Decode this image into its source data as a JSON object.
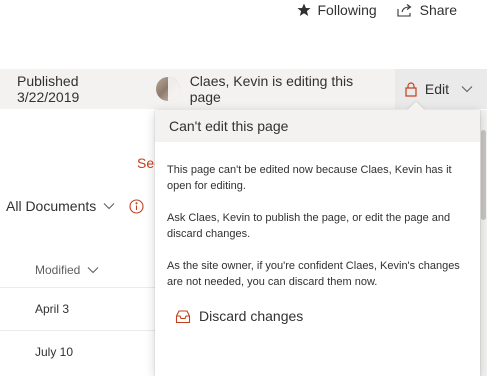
{
  "top_actions": {
    "following_label": "Following",
    "share_label": "Share"
  },
  "status_bar": {
    "published": "Published 3/22/2019",
    "editing_text": "Claes, Kevin is editing this page",
    "edit_label": "Edit"
  },
  "background": {
    "see_link": "See",
    "all_documents": "All Documents",
    "column_modified": "Modified",
    "rows": [
      "April 3",
      "July 10"
    ]
  },
  "callout": {
    "title": "Can't edit this page",
    "paragraphs": [
      "This page can't be edited now because Claes, Kevin has it open for editing.",
      "Ask Claes, Kevin to publish the page, or edit the page and discard changes.",
      "As the site owner, if you're confident Claes, Kevin's changes are not needed, you can discard them now."
    ],
    "discard_label": "Discard changes"
  },
  "colors": {
    "accent": "#c43e1c",
    "status_bar_bg": "#f3f2f1",
    "text": "#323130"
  },
  "icons": {
    "following": "star-icon",
    "share": "share-icon",
    "edit": "lock-icon",
    "edit_dropdown": "chevron-down-icon",
    "view_dropdown": "chevron-down-icon",
    "info": "info-icon",
    "sort": "chevron-down-icon",
    "discard": "discard-icon"
  }
}
